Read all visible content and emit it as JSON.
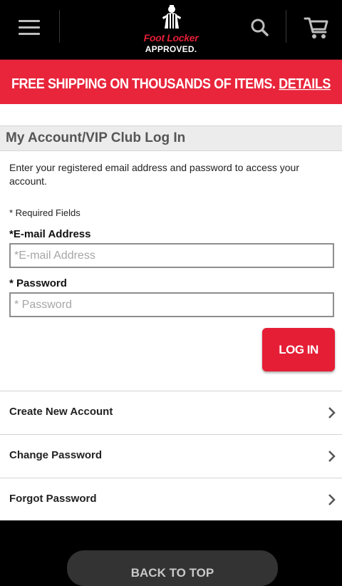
{
  "header": {
    "logo_brand": "Foot Locker",
    "logo_tagline": "APPROVED.",
    "icons": {
      "menu": "hamburger-menu-icon",
      "search": "search-icon",
      "cart": "cart-icon",
      "logo": "referee-mascot-icon"
    }
  },
  "promo": {
    "text": "FREE SHIPPING ON THOUSANDS OF ITEMS. ",
    "link": "DETAILS"
  },
  "section_title": "My Account/VIP Club Log In",
  "form": {
    "intro": "Enter your registered email address and password to access your account.",
    "required_note": "* Required Fields",
    "email_label": "*E-mail Address",
    "email_placeholder": "*E-mail Address",
    "email_value": "",
    "password_label": "* Password",
    "password_placeholder": "* Password",
    "password_value": "",
    "login_label": "LOG IN"
  },
  "links": [
    {
      "label": "Create New Account",
      "icon": "chevron-right-icon"
    },
    {
      "label": "Change Password",
      "icon": "chevron-right-icon"
    },
    {
      "label": "Forgot Password",
      "icon": "chevron-right-icon"
    }
  ],
  "footer": {
    "back_to_top": "BACK TO TOP"
  },
  "colors": {
    "accent": "#e8253b",
    "header_bg": "#000000",
    "section_bg": "#ececec"
  }
}
